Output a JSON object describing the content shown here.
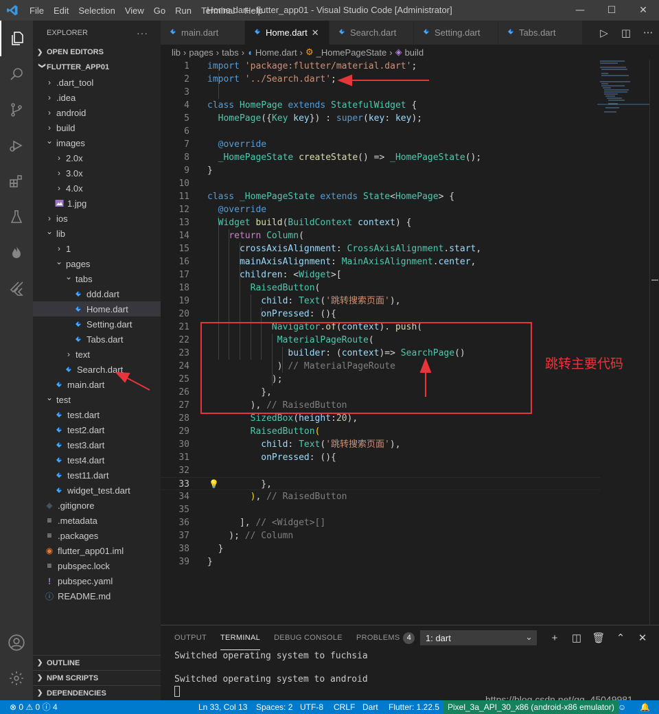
{
  "window": {
    "title": "Home.dart - flutter_app01 - Visual Studio Code [Administrator]",
    "menu": [
      "File",
      "Edit",
      "Selection",
      "View",
      "Go",
      "Run",
      "Terminal",
      "Help"
    ]
  },
  "sidebar": {
    "header": "EXPLORER",
    "open_editors": "OPEN EDITORS",
    "project": "FLUTTER_APP01",
    "tree": [
      {
        "label": ".dart_tool",
        "indent": 1,
        "type": "folder",
        "open": false
      },
      {
        "label": ".idea",
        "indent": 1,
        "type": "folder",
        "open": false
      },
      {
        "label": "android",
        "indent": 1,
        "type": "folder",
        "open": false
      },
      {
        "label": "build",
        "indent": 1,
        "type": "folder",
        "open": false
      },
      {
        "label": "images",
        "indent": 1,
        "type": "folder",
        "open": true
      },
      {
        "label": "2.0x",
        "indent": 2,
        "type": "folder",
        "open": false
      },
      {
        "label": "3.0x",
        "indent": 2,
        "type": "folder",
        "open": false
      },
      {
        "label": "4.0x",
        "indent": 2,
        "type": "folder",
        "open": false
      },
      {
        "label": "1.jpg",
        "indent": 2,
        "type": "image"
      },
      {
        "label": "ios",
        "indent": 1,
        "type": "folder",
        "open": false
      },
      {
        "label": "lib",
        "indent": 1,
        "type": "folder",
        "open": true
      },
      {
        "label": "1",
        "indent": 2,
        "type": "folder",
        "open": false
      },
      {
        "label": "pages",
        "indent": 2,
        "type": "folder",
        "open": true
      },
      {
        "label": "tabs",
        "indent": 3,
        "type": "folder",
        "open": true
      },
      {
        "label": "ddd.dart",
        "indent": 4,
        "type": "dart"
      },
      {
        "label": "Home.dart",
        "indent": 4,
        "type": "dart",
        "selected": true
      },
      {
        "label": "Setting.dart",
        "indent": 4,
        "type": "dart"
      },
      {
        "label": "Tabs.dart",
        "indent": 4,
        "type": "dart"
      },
      {
        "label": "text",
        "indent": 3,
        "type": "folder",
        "open": false
      },
      {
        "label": "Search.dart",
        "indent": 3,
        "type": "dart"
      },
      {
        "label": "main.dart",
        "indent": 2,
        "type": "dart"
      },
      {
        "label": "test",
        "indent": 1,
        "type": "folder",
        "open": true
      },
      {
        "label": "test.dart",
        "indent": 2,
        "type": "dart"
      },
      {
        "label": "test2.dart",
        "indent": 2,
        "type": "dart"
      },
      {
        "label": "test3.dart",
        "indent": 2,
        "type": "dart"
      },
      {
        "label": "test4.dart",
        "indent": 2,
        "type": "dart"
      },
      {
        "label": "test11.dart",
        "indent": 2,
        "type": "dart"
      },
      {
        "label": "widget_test.dart",
        "indent": 2,
        "type": "dart"
      },
      {
        "label": ".gitignore",
        "indent": 1,
        "type": "git"
      },
      {
        "label": ".metadata",
        "indent": 1,
        "type": "lines"
      },
      {
        "label": ".packages",
        "indent": 1,
        "type": "lines"
      },
      {
        "label": "flutter_app01.iml",
        "indent": 1,
        "type": "rss"
      },
      {
        "label": "pubspec.lock",
        "indent": 1,
        "type": "lines"
      },
      {
        "label": "pubspec.yaml",
        "indent": 1,
        "type": "excl"
      },
      {
        "label": "README.md",
        "indent": 1,
        "type": "info"
      }
    ],
    "bottom_sections": [
      "OUTLINE",
      "NPM SCRIPTS",
      "DEPENDENCIES"
    ]
  },
  "tabs": [
    {
      "label": "main.dart",
      "active": false
    },
    {
      "label": "Home.dart",
      "active": true
    },
    {
      "label": "Search.dart",
      "active": false
    },
    {
      "label": "Setting.dart",
      "active": false
    },
    {
      "label": "Tabs.dart",
      "active": false
    }
  ],
  "breadcrumb": [
    "lib",
    "pages",
    "tabs",
    "Home.dart",
    "_HomePageState",
    "build"
  ],
  "code": [
    [
      [
        "k",
        "import"
      ],
      [
        "p",
        " "
      ],
      [
        "s",
        "'package:flutter/material.dart'"
      ],
      [
        "p",
        ";"
      ]
    ],
    [
      [
        "k",
        "import"
      ],
      [
        "p",
        " "
      ],
      [
        "s",
        "'../Search.dart'"
      ],
      [
        "p",
        ";"
      ]
    ],
    [],
    [
      [
        "k",
        "class"
      ],
      [
        "p",
        " "
      ],
      [
        "t",
        "HomePage"
      ],
      [
        "p",
        " "
      ],
      [
        "k",
        "extends"
      ],
      [
        "p",
        " "
      ],
      [
        "t",
        "StatefulWidget"
      ],
      [
        "p",
        " {"
      ]
    ],
    [
      [
        "p",
        "  "
      ],
      [
        "t",
        "HomePage"
      ],
      [
        "p",
        "({"
      ],
      [
        "t",
        "Key"
      ],
      [
        "p",
        " "
      ],
      [
        "v",
        "key"
      ],
      [
        "p",
        "}) : "
      ],
      [
        "k",
        "super"
      ],
      [
        "p",
        "("
      ],
      [
        "v",
        "key"
      ],
      [
        "p",
        ": "
      ],
      [
        "v",
        "key"
      ],
      [
        "p",
        ");"
      ]
    ],
    [],
    [
      [
        "p",
        "  "
      ],
      [
        "k",
        "@override"
      ]
    ],
    [
      [
        "p",
        "  "
      ],
      [
        "t",
        "_HomePageState"
      ],
      [
        "p",
        " "
      ],
      [
        "f",
        "createState"
      ],
      [
        "p",
        "() => "
      ],
      [
        "t",
        "_HomePageState"
      ],
      [
        "p",
        "();"
      ]
    ],
    [
      [
        "p",
        "}"
      ]
    ],
    [],
    [
      [
        "k",
        "class"
      ],
      [
        "p",
        " "
      ],
      [
        "t",
        "_HomePageState"
      ],
      [
        "p",
        " "
      ],
      [
        "k",
        "extends"
      ],
      [
        "p",
        " "
      ],
      [
        "t",
        "State"
      ],
      [
        "p",
        "<"
      ],
      [
        "t",
        "HomePage"
      ],
      [
        "p",
        "> {"
      ]
    ],
    [
      [
        "p",
        "  "
      ],
      [
        "k",
        "@override"
      ]
    ],
    [
      [
        "p",
        "  "
      ],
      [
        "t",
        "Widget"
      ],
      [
        "p",
        " "
      ],
      [
        "f",
        "build"
      ],
      [
        "p",
        "("
      ],
      [
        "t",
        "BuildContext"
      ],
      [
        "p",
        " "
      ],
      [
        "v",
        "context"
      ],
      [
        "p",
        ") {"
      ]
    ],
    [
      [
        "p",
        "    "
      ],
      [
        "c",
        "return"
      ],
      [
        "p",
        " "
      ],
      [
        "t",
        "Column"
      ],
      [
        "p",
        "("
      ]
    ],
    [
      [
        "p",
        "      "
      ],
      [
        "v",
        "crossAxisAlignment"
      ],
      [
        "p",
        ": "
      ],
      [
        "t",
        "CrossAxisAlignment"
      ],
      [
        "p",
        "."
      ],
      [
        "v",
        "start"
      ],
      [
        "p",
        ","
      ]
    ],
    [
      [
        "p",
        "      "
      ],
      [
        "v",
        "mainAxisAlignment"
      ],
      [
        "p",
        ": "
      ],
      [
        "t",
        "MainAxisAlignment"
      ],
      [
        "p",
        "."
      ],
      [
        "v",
        "center"
      ],
      [
        "p",
        ","
      ]
    ],
    [
      [
        "p",
        "      "
      ],
      [
        "v",
        "children"
      ],
      [
        "p",
        ": <"
      ],
      [
        "t",
        "Widget"
      ],
      [
        "p",
        ">["
      ]
    ],
    [
      [
        "p",
        "        "
      ],
      [
        "t",
        "RaisedButton"
      ],
      [
        "p",
        "("
      ]
    ],
    [
      [
        "p",
        "          "
      ],
      [
        "v",
        "child"
      ],
      [
        "p",
        ": "
      ],
      [
        "t",
        "Text"
      ],
      [
        "p",
        "("
      ],
      [
        "s",
        "'跳转搜索页面'"
      ],
      [
        "p",
        "),"
      ]
    ],
    [
      [
        "p",
        "          "
      ],
      [
        "v",
        "onPressed"
      ],
      [
        "p",
        ": (){"
      ]
    ],
    [
      [
        "p",
        "            "
      ],
      [
        "t",
        "Navigator"
      ],
      [
        "p",
        "."
      ],
      [
        "f",
        "of"
      ],
      [
        "p",
        "("
      ],
      [
        "v",
        "context"
      ],
      [
        "p",
        "). "
      ],
      [
        "f",
        "push"
      ],
      [
        "p",
        "("
      ]
    ],
    [
      [
        "p",
        "             "
      ],
      [
        "t",
        "MaterialPageRoute"
      ],
      [
        "p",
        "("
      ]
    ],
    [
      [
        "p",
        "               "
      ],
      [
        "v",
        "builder"
      ],
      [
        "p",
        ": ("
      ],
      [
        "v",
        "context"
      ],
      [
        "p",
        ")=> "
      ],
      [
        "t",
        "SearchPage"
      ],
      [
        "p",
        "()"
      ]
    ],
    [
      [
        "p",
        "             ) "
      ],
      [
        "cm",
        "// MaterialPageRoute"
      ]
    ],
    [
      [
        "p",
        "            );"
      ]
    ],
    [
      [
        "p",
        "          },"
      ]
    ],
    [
      [
        "p",
        "        ), "
      ],
      [
        "cm",
        "// RaisedButton"
      ]
    ],
    [
      [
        "p",
        "        "
      ],
      [
        "t",
        "SizedBox"
      ],
      [
        "p",
        "("
      ],
      [
        "v",
        "height"
      ],
      [
        "p",
        ":"
      ],
      [
        "n",
        "20"
      ],
      [
        "p",
        "),"
      ]
    ],
    [
      [
        "p",
        "        "
      ],
      [
        "t",
        "RaisedButton"
      ],
      [
        "y",
        "("
      ]
    ],
    [
      [
        "p",
        "          "
      ],
      [
        "v",
        "child"
      ],
      [
        "p",
        ": "
      ],
      [
        "t",
        "Text"
      ],
      [
        "p",
        "("
      ],
      [
        "s",
        "'跳转搜索页面'"
      ],
      [
        "p",
        "),"
      ]
    ],
    [
      [
        "p",
        "          "
      ],
      [
        "v",
        "onPressed"
      ],
      [
        "p",
        ": (){"
      ]
    ],
    [],
    [
      [
        "p",
        "          },"
      ]
    ],
    [
      [
        "p",
        "        "
      ],
      [
        "y",
        ")"
      ],
      [
        "p",
        ", "
      ],
      [
        "cm",
        "// RaisedButton"
      ]
    ],
    [],
    [
      [
        "p",
        "      ], "
      ],
      [
        "cm",
        "// <Widget>[]"
      ]
    ],
    [
      [
        "p",
        "    ); "
      ],
      [
        "cm",
        "// Column"
      ]
    ],
    [
      [
        "p",
        "  }"
      ]
    ],
    [
      [
        "p",
        "}"
      ]
    ]
  ],
  "annotation": {
    "text": "跳转主要代码",
    "color": "#e8353b"
  },
  "panel": {
    "tabs": [
      "OUTPUT",
      "TERMINAL",
      "DEBUG CONSOLE",
      "PROBLEMS"
    ],
    "active_tab": "TERMINAL",
    "problems_count": "4",
    "terminal_select": "1: dart",
    "terminal_lines": [
      "Switched operating system to fuchsia",
      "",
      "Switched operating system to android"
    ]
  },
  "statusbar": {
    "errors": "0",
    "warnings": "0",
    "info": "4",
    "position": "Ln 33, Col 13",
    "spaces": "Spaces: 2",
    "encoding": "UTF-8",
    "eol": "CRLF",
    "language": "Dart",
    "flutter": "Flutter: 1.22.5",
    "device": "Pixel_3a_API_30_x86 (android-x86 emulator)"
  },
  "watermark": "https://blog.csdn.net/qq_45049981",
  "colors": {
    "accent": "#007acc",
    "annotation": "#e8353b",
    "device_item": "#16825d"
  }
}
